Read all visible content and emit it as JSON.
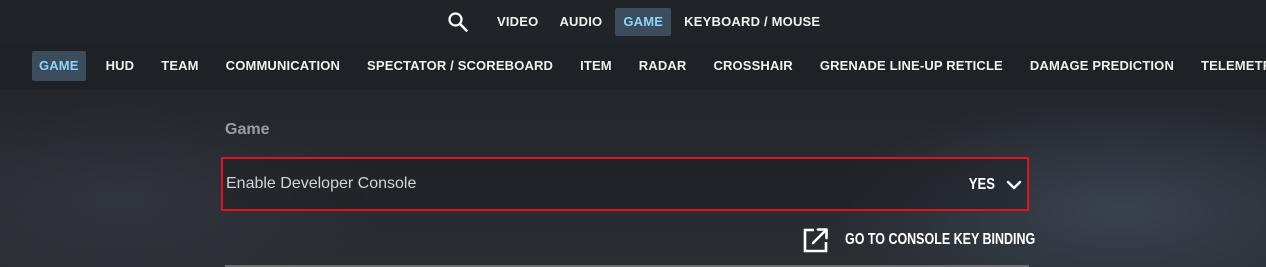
{
  "top_nav": {
    "search_icon": "search-icon",
    "tabs": [
      {
        "label": "VIDEO",
        "active": false
      },
      {
        "label": "AUDIO",
        "active": false
      },
      {
        "label": "GAME",
        "active": true
      },
      {
        "label": "KEYBOARD / MOUSE",
        "active": false
      }
    ]
  },
  "sub_nav": {
    "tabs": [
      {
        "label": "GAME",
        "active": true
      },
      {
        "label": "HUD",
        "active": false
      },
      {
        "label": "TEAM",
        "active": false
      },
      {
        "label": "COMMUNICATION",
        "active": false
      },
      {
        "label": "SPECTATOR / SCOREBOARD",
        "active": false
      },
      {
        "label": "ITEM",
        "active": false
      },
      {
        "label": "RADAR",
        "active": false
      },
      {
        "label": "CROSSHAIR",
        "active": false
      },
      {
        "label": "GRENADE LINE-UP RETICLE",
        "active": false
      },
      {
        "label": "DAMAGE PREDICTION",
        "active": false
      },
      {
        "label": "TELEMETRY",
        "active": false
      }
    ]
  },
  "section": {
    "title": "Game",
    "setting": {
      "label": "Enable Developer Console",
      "value": "YES",
      "dropdown_icon": "chevron-down-icon"
    },
    "link": {
      "label": "GO TO CONSOLE KEY BINDING",
      "icon": "external-link-icon"
    }
  },
  "colors": {
    "accent_active_bg": "#3b4c5b",
    "accent_active_text": "#8fd3ff",
    "highlight_border": "#e0141b"
  }
}
